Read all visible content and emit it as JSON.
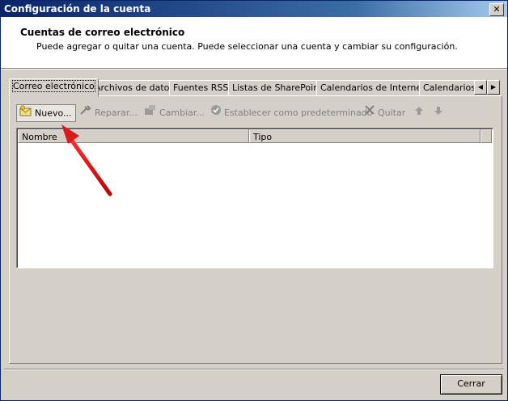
{
  "window": {
    "title": "Configuración de la cuenta",
    "close_glyph": "✕"
  },
  "header": {
    "title": "Cuentas de correo electrónico",
    "description": "Puede agregar o quitar una cuenta. Puede seleccionar una cuenta y cambiar su configuración."
  },
  "tabs": [
    {
      "label": "Correo electrónico"
    },
    {
      "label": "Archivos de datos"
    },
    {
      "label": "Fuentes RSS"
    },
    {
      "label": "Listas de SharePoint"
    },
    {
      "label": "Calendarios de Internet"
    },
    {
      "label": "Calendarios p"
    }
  ],
  "toolbar": {
    "nuevo": "Nuevo...",
    "reparar": "Reparar...",
    "cambiar": "Cambiar...",
    "predeterminado": "Establecer como predeterminado",
    "quitar": "Quitar"
  },
  "list": {
    "columns": [
      "Nombre",
      "Tipo"
    ],
    "rows": []
  },
  "footer": {
    "close_label": "Cerrar"
  },
  "icons": [
    "new-account-icon",
    "repair-icon",
    "change-icon",
    "set-default-icon",
    "remove-icon",
    "move-up-icon",
    "move-down-icon",
    "tab-scroll-left-icon",
    "tab-scroll-right-icon"
  ],
  "colors": {
    "titlebar": "#0a246a",
    "face": "#d4d0c8",
    "annotation_arrow": "#e01818"
  }
}
